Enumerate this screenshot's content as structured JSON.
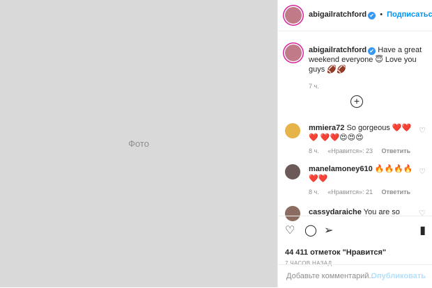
{
  "media": {
    "placeholder_label": "Фото"
  },
  "header": {
    "username": "abigailratchford",
    "verified_icon": "✔",
    "follow_label": "Подписаться"
  },
  "caption": {
    "username": "abigailratchford",
    "text": "Have a great weekend everyone 😇 Love you guys 🏈🏈",
    "time": "7 ч."
  },
  "load_more_icon": "+",
  "comments": [
    {
      "username": "mmiera72",
      "text": "So gorgeous ❤️❤️❤️ ❤️❤️😍😍😍",
      "time": "8 ч.",
      "likes": "«Нравится»: 23",
      "reply": "Ответить"
    },
    {
      "username": "manelamoney610",
      "text": "🔥🔥🔥🔥 ❤️❤️",
      "time": "8 ч.",
      "likes": "«Нравится»: 21",
      "reply": "Ответить"
    },
    {
      "username": "cassydaraiche",
      "text": "You are so"
    }
  ],
  "actions": {
    "like_icon": "♡",
    "comment_icon": "◯",
    "share_icon": "➢",
    "save_icon": "▮",
    "likes_text": "44 411 отметок \"Нравится\"",
    "posted_time": "7 ЧАСОВ НАЗАД"
  },
  "add_comment": {
    "placeholder": "Добавьте комментарий...",
    "publish_label": "Опубликовать"
  }
}
